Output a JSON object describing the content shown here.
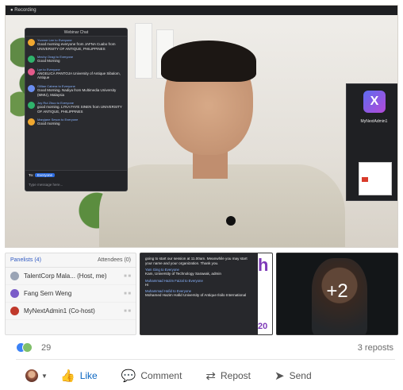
{
  "meeting": {
    "recording_label": "Recording",
    "chat": {
      "title": "Webinar Chat",
      "messages": [
        {
          "sender": "Yvonne Lee to Everyone",
          "text": "Good morning everyone from JAFNA Cuabo from UNIVERSITY OF ANTIQUE, PHILIPPINES",
          "color": "#f0a830"
        },
        {
          "sender": "Mechy Oragi to Everyone",
          "text": "Good Morning",
          "color": "#2fb36b"
        },
        {
          "sender": "Lyn to Everyone",
          "text": "ANGELICA PANTOJA University of Antique Sibalom, Antique",
          "color": "#e45a8b"
        },
        {
          "sender": "Gillian Cabera to Everyone",
          "text": "Good Morning. Nadiya from Multimedia University (MMU), Malaysia",
          "color": "#6a8df0"
        },
        {
          "sender": "Joy Rui Zhuo to Everyone",
          "text": "good morning. LYKA FAYE SINEN from UNIVERSITY OF ANTIQUE, PHILIPPINES",
          "color": "#2fb36b"
        },
        {
          "sender": "Maryjane Seson to Everyone",
          "text": "Good morning",
          "color": "#f0a830"
        }
      ],
      "to_label": "To:",
      "to_value": "Everyone",
      "input_placeholder": "Type message here..."
    },
    "participant_name": "MyNextAdmin1",
    "logo_letter": "X"
  },
  "thumbnails": {
    "panelists": {
      "tab_active": "Panelists (4)",
      "tab_other": "Attendees (0)",
      "rows": [
        {
          "name": "TalentCorp Mala... (Host, me)",
          "color": "#9aa4b5"
        },
        {
          "name": "Fang Sern Weng",
          "color": "#7a5cc8"
        },
        {
          "name": "MyNextAdmin1 (Co-host)",
          "color": "#c0392b"
        }
      ]
    },
    "chat_preview": {
      "lines": [
        {
          "sender": "",
          "text": "going to start our session at 11.00am. Meanwhile you may start your name and your organization. Thank you."
        },
        {
          "sender": "Yam Ging to Everyone",
          "text": "Kam, University of Technology Sarawak, admin"
        },
        {
          "sender": "Muhammad Hazim Faizal to Everyone",
          "text": "Hi"
        },
        {
          "sender": "Muhammad Hafid to Everyone",
          "text": "Mohamed Hazim Hafid University of Antique Iloilo International"
        }
      ],
      "side_text": "h",
      "side_number": "20"
    },
    "overflow_count": "+2"
  },
  "social": {
    "reaction_count": "29",
    "reposts": "3 reposts",
    "actions": {
      "like": "Like",
      "comment": "Comment",
      "repost": "Repost",
      "send": "Send"
    }
  },
  "colors": {
    "like_blue": "#0a66c2",
    "dark_panel": "#2a2b2f"
  }
}
